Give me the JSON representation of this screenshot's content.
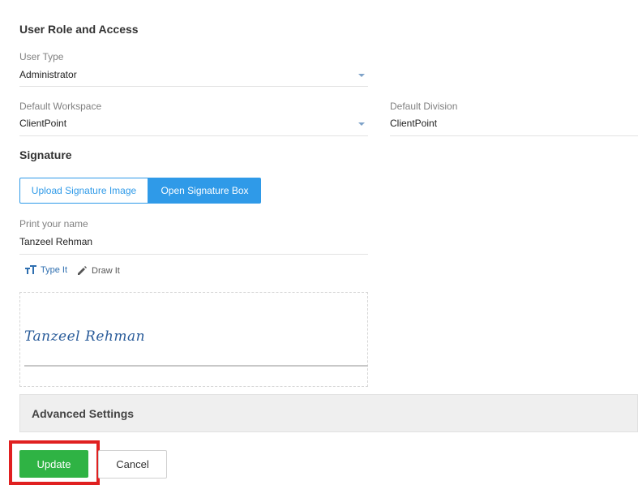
{
  "role_section": {
    "title": "User Role and Access",
    "user_type": {
      "label": "User Type",
      "value": "Administrator"
    },
    "default_workspace": {
      "label": "Default Workspace",
      "value": "ClientPoint"
    },
    "default_division": {
      "label": "Default Division",
      "value": "ClientPoint"
    }
  },
  "signature_section": {
    "title": "Signature",
    "upload_label": "Upload Signature Image",
    "open_box_label": "Open Signature Box",
    "print_name": {
      "label": "Print your name",
      "value": "Tanzeel Rehman"
    },
    "modes": {
      "type_label": "Type It",
      "draw_label": "Draw It"
    },
    "signature_text": "Tanzeel Rehman"
  },
  "advanced": {
    "title": "Advanced Settings"
  },
  "actions": {
    "update_label": "Update",
    "cancel_label": "Cancel"
  },
  "colors": {
    "accent": "#2f9ae8",
    "success": "#2fb344",
    "highlight": "#e02020"
  }
}
